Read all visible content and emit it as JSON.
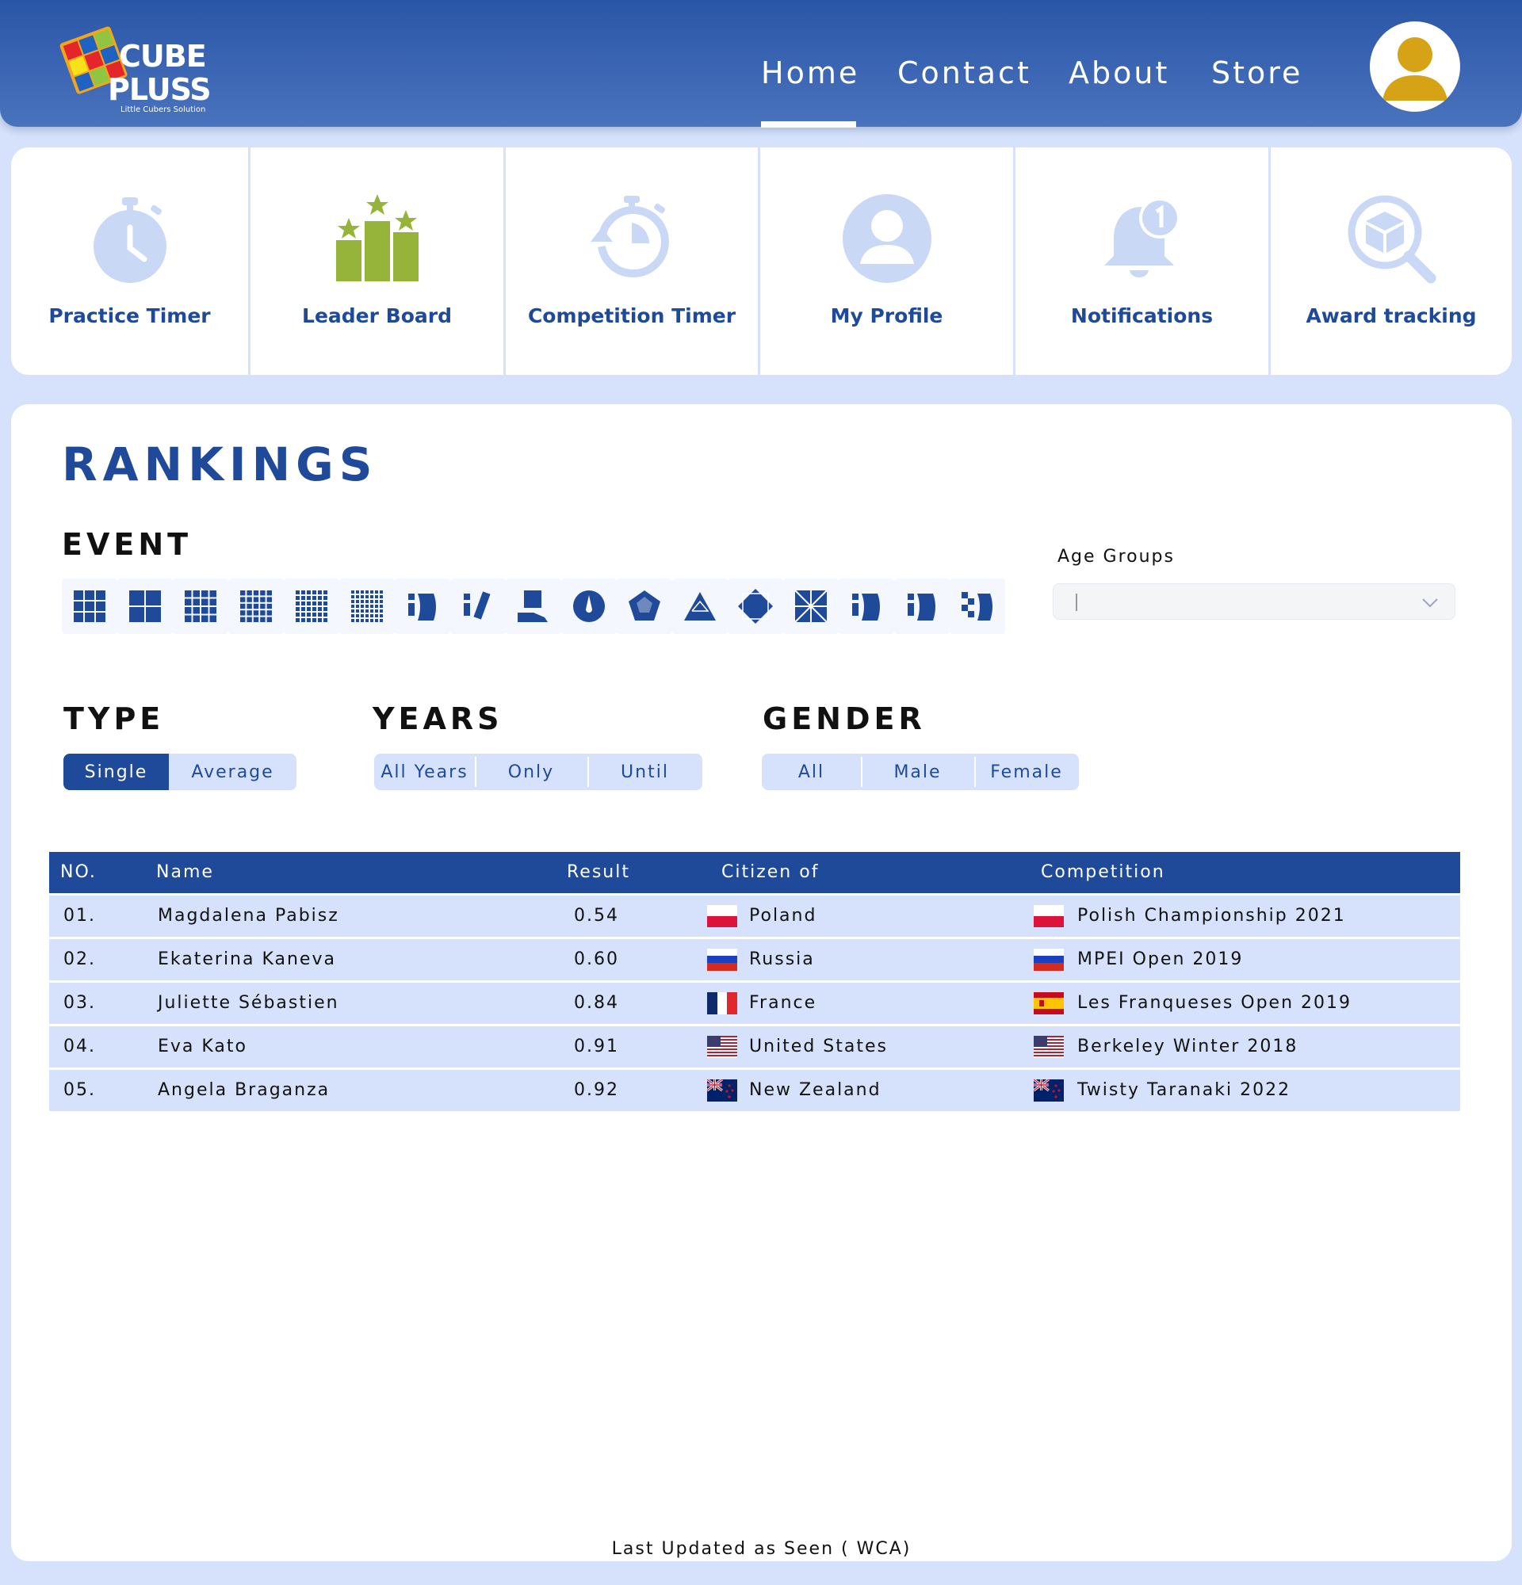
{
  "brand": {
    "line1": "CUBE",
    "line2": "PLUSS",
    "tagline": "Little Cubers Solution"
  },
  "nav": {
    "items": [
      {
        "label": "Home",
        "active": true
      },
      {
        "label": "Contact",
        "active": false
      },
      {
        "label": "About",
        "active": false
      },
      {
        "label": "Store",
        "active": false
      }
    ]
  },
  "tiles": [
    {
      "label": "Practice Timer",
      "icon": "stopwatch-icon"
    },
    {
      "label": "Leader Board",
      "icon": "podium-stars-icon"
    },
    {
      "label": "Competition Timer",
      "icon": "timer-refresh-icon"
    },
    {
      "label": "My Profile",
      "icon": "user-circle-icon"
    },
    {
      "label": "Notifications",
      "icon": "bell-badge-icon"
    },
    {
      "label": "Award tracking",
      "icon": "box-search-icon"
    }
  ],
  "rankings": {
    "title": "RANKINGS",
    "event_label": "EVENT",
    "events": [
      "3x3x3",
      "2x2x2",
      "4x4x4",
      "5x5x5",
      "6x6x6",
      "7x7x7",
      "3x3x3 Blindfolded",
      "3x3x3 Fewest Moves",
      "3x3x3 One-Handed",
      "Clock",
      "Megaminx",
      "Pyraminx",
      "Skewb",
      "Square-1",
      "4x4x4 Blindfolded",
      "5x5x5 Blindfolded",
      "3x3x3 Multi-Blind"
    ],
    "age_groups_label": "Age Groups",
    "age_groups_value": "",
    "type_label": "TYPE",
    "type_options": [
      "Single",
      "Average"
    ],
    "type_selected": "Single",
    "years_label": "YEARS",
    "years_options": [
      "All Years",
      "Only",
      "Until"
    ],
    "gender_label": "GENDER",
    "gender_options": [
      "All",
      "Male",
      "Female"
    ]
  },
  "table": {
    "headers": {
      "no": "NO.",
      "name": "Name",
      "result": "Result",
      "citizen": "Citizen of",
      "competition": "Competition"
    },
    "rows": [
      {
        "no": "01.",
        "name": "Magdalena Pabisz",
        "result": "0.54",
        "citizen": "Poland",
        "citizen_flag": "poland-flag-icon",
        "competition": "Polish Championship 2021",
        "competition_flag": "poland-flag-icon"
      },
      {
        "no": "02.",
        "name": "Ekaterina Kaneva",
        "result": "0.60",
        "citizen": "Russia",
        "citizen_flag": "russia-flag-icon",
        "competition": "MPEI Open 2019",
        "competition_flag": "russia-flag-icon"
      },
      {
        "no": "03.",
        "name": "Juliette Sébastien",
        "result": "0.84",
        "citizen": "France",
        "citizen_flag": "france-flag-icon",
        "competition": "Les Franqueses Open 2019",
        "competition_flag": "spain-flag-icon"
      },
      {
        "no": "04.",
        "name": "Eva Kato",
        "result": "0.91",
        "citizen": "United States",
        "citizen_flag": "usa-flag-icon",
        "competition": "Berkeley Winter 2018",
        "competition_flag": "usa-flag-icon"
      },
      {
        "no": "05.",
        "name": "Angela Braganza",
        "result": "0.92",
        "citizen": "New Zealand",
        "citizen_flag": "new-zealand-flag-icon",
        "competition": "Twisty Taranaki 2022",
        "competition_flag": "new-zealand-flag-icon"
      }
    ]
  },
  "footer_note": "Last Updated as Seen ( WCA)",
  "colors": {
    "primary": "#1f4a9a",
    "header_gradient_top": "#2a56a7",
    "page_bg": "#d6e2fb",
    "tile_icon": "#c9d9f5",
    "leaderboard_icon": "#96b33a",
    "avatar_gold": "#d5a315"
  }
}
